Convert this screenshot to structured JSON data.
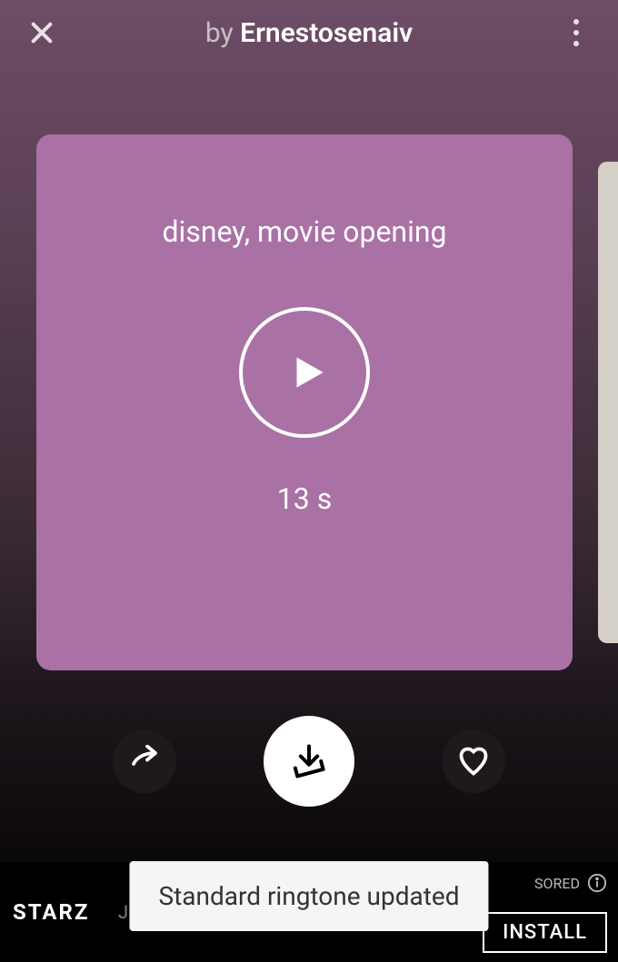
{
  "header": {
    "by_prefix": "by ",
    "author": "Ernestosenaiv"
  },
  "card": {
    "title": "disney, movie opening",
    "duration": "13 s"
  },
  "toast": {
    "message": "Standard ringtone updated"
  },
  "ad": {
    "logo": "STARZ",
    "text": "J.K. Simmons in @Counterpart",
    "sponsored_label": "SORED",
    "install_label": "INSTALL"
  }
}
